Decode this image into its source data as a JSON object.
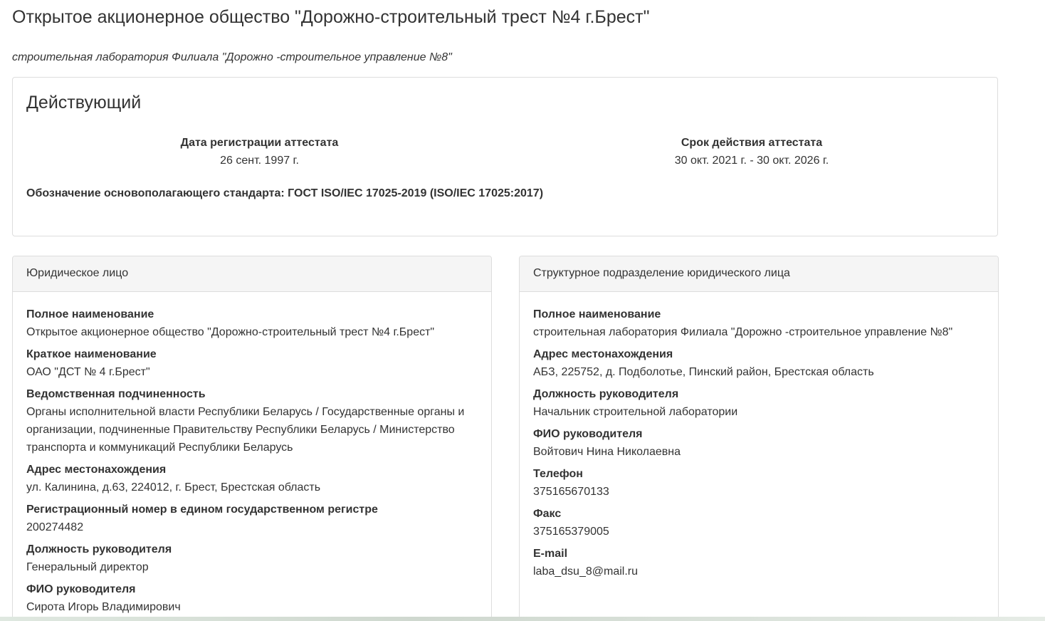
{
  "header": {
    "org_title": "Открытое акционерное общество \"Дорожно-строительный трест №4 г.Брест\"",
    "lab_subtitle": "строительная лаборатория Филиала \"Дорожно -строительное управление №8\""
  },
  "status": {
    "heading": "Действующий",
    "registration_label": "Дата регистрации аттестата",
    "registration_value": "26 сент. 1997 г.",
    "validity_label": "Срок действия аттестата",
    "validity_value": "30 окт. 2021 г. - 30 окт. 2026 г.",
    "standard_line": "Обозначение основополагающего стандарта: ГОСТ ISO/IEC 17025-2019 (ISO/IEC 17025:2017)"
  },
  "legal_entity": {
    "header": "Юридическое лицо",
    "fields": [
      {
        "label": "Полное наименование",
        "value": "Открытое акционерное общество \"Дорожно-строительный трест №4 г.Брест\""
      },
      {
        "label": "Краткое наименование",
        "value": "ОАО \"ДСТ № 4 г.Брест\""
      },
      {
        "label": "Ведомственная подчиненность",
        "value": "Органы исполнительной власти Республики Беларусь / Государственные органы и организации, подчиненные Правительству Республики Беларусь / Министерство транспорта и коммуникаций Республики Беларусь"
      },
      {
        "label": "Адрес местонахождения",
        "value": "ул. Калинина, д.63, 224012, г. Брест, Брестская область"
      },
      {
        "label": "Регистрационный номер в едином государственном регистре",
        "value": "200274482"
      },
      {
        "label": "Должность руководителя",
        "value": "Генеральный директор"
      },
      {
        "label": "ФИО руководителя",
        "value": "Сирота Игорь Владимирович"
      }
    ]
  },
  "structural_unit": {
    "header": "Структурное подразделение юридического лица",
    "fields": [
      {
        "label": "Полное наименование",
        "value": "строительная лаборатория Филиала \"Дорожно -строительное управление №8\""
      },
      {
        "label": "Адрес местонахождения",
        "value": "АБЗ, 225752, д. Подболотье, Пинский район, Брестская область"
      },
      {
        "label": "Должность руководителя",
        "value": "Начальник строительной лаборатории"
      },
      {
        "label": "ФИО руководителя",
        "value": "Войтович Нина Николаевна"
      },
      {
        "label": "Телефон",
        "value": "375165670133"
      },
      {
        "label": "Факс",
        "value": "375165379005"
      },
      {
        "label": "E-mail",
        "value": "laba_dsu_8@mail.ru"
      }
    ]
  }
}
